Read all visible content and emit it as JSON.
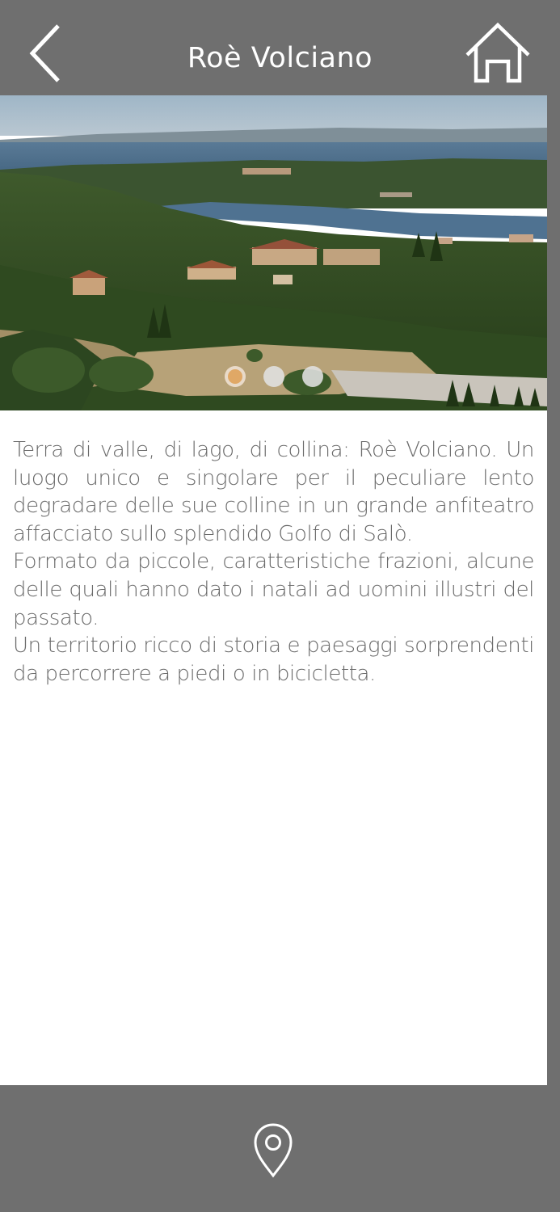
{
  "header": {
    "title": "Roè Volciano",
    "back_icon": "chevron-left-icon",
    "home_icon": "home-icon"
  },
  "hero": {
    "image": "landscape photo: hills, village and lake",
    "slides_total": 3,
    "active_slide": 1,
    "active_dot_color": "#e0a866"
  },
  "description": {
    "paragraphs": [
      "Terra di valle, di lago, di collina: Roè Volciano. Un luogo unico e singolare per il peculiare lento degradare delle sue colline in un grande anfiteatro affacciato sullo splendido Golfo di Salò.",
      "Formato da piccole, caratteristiche frazioni, alcune delle quali hanno dato i natali ad uomini illustri del passato.",
      "Un territorio ricco di storia e paesaggi sorprendenti da percorrere a piedi o in bicicletta."
    ]
  },
  "footer": {
    "map_icon": "map-pin-icon"
  },
  "colors": {
    "bar": "#6f6f6f",
    "text": "#6a6a6a",
    "background": "#ffffff"
  }
}
